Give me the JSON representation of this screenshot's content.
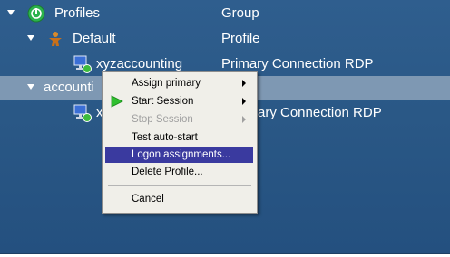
{
  "tree": {
    "header": {
      "name": "Profiles",
      "type": "Group"
    },
    "rows": [
      {
        "name": "Default",
        "type": "Profile"
      },
      {
        "name": "xyzaccounting",
        "type": "Primary Connection RDP"
      },
      {
        "name": "accounti",
        "type": ""
      },
      {
        "name": "x",
        "type": "ary Connection RDP"
      }
    ]
  },
  "context_menu": {
    "items": [
      {
        "label": "Assign primary",
        "submenu": true,
        "enabled": true
      },
      {
        "label": "Start Session",
        "submenu": true,
        "enabled": true
      },
      {
        "label": "Stop Session",
        "submenu": true,
        "enabled": false
      },
      {
        "label": "Test auto-start",
        "submenu": false,
        "enabled": true
      },
      {
        "label": "Logon assignments...",
        "submenu": false,
        "enabled": true,
        "highlighted": true
      },
      {
        "label": "Delete Profile...",
        "submenu": false,
        "enabled": true
      },
      {
        "label": "Cancel",
        "submenu": false,
        "enabled": true
      }
    ]
  },
  "colors": {
    "panel_background": "#2a5886",
    "selected_row": "#7e98b3",
    "menu_background": "#f0efe9",
    "menu_highlight": "#3a3a9f",
    "profiles_icon": "#2bb24c",
    "start_arrow": "#2fbf2f"
  },
  "icons": {
    "profiles": "green-circle-icon",
    "profile": "person-icon",
    "connection": "monitor-connection-icon",
    "start_session": "play-arrow-icon"
  }
}
